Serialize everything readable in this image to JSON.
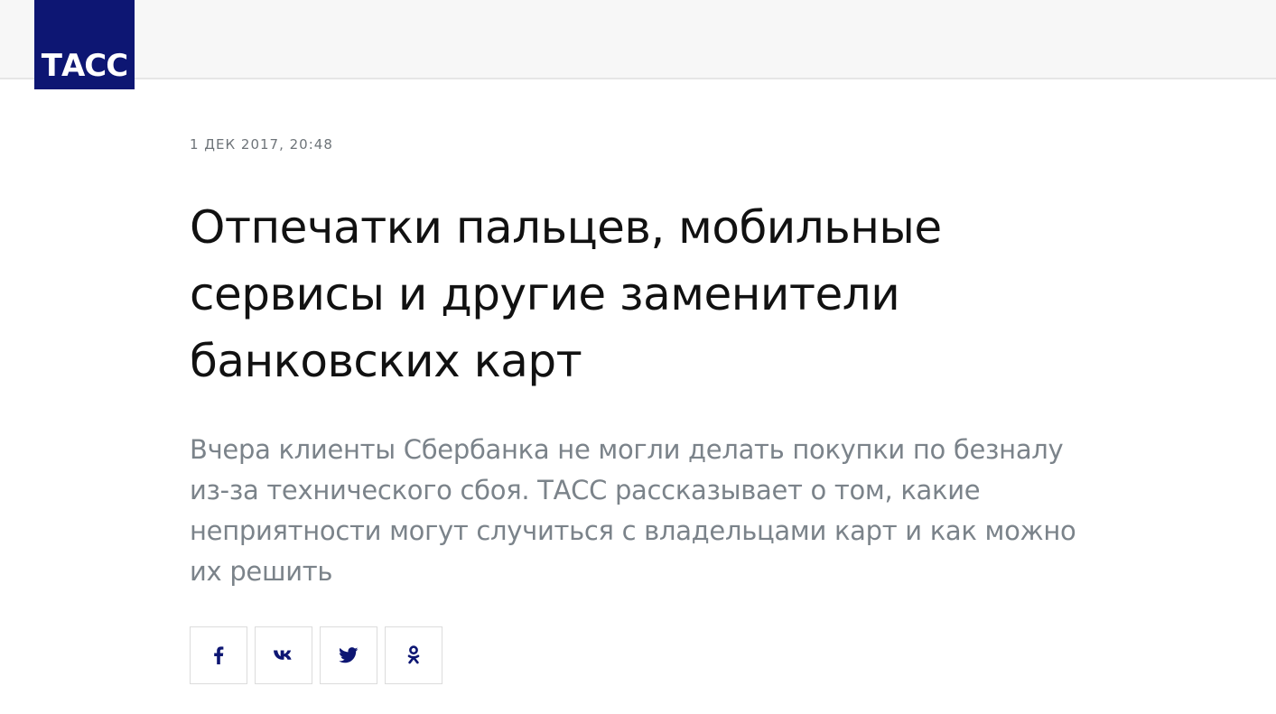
{
  "header": {
    "logo_text": "ТАСС",
    "brand_color": "#0d1673"
  },
  "article": {
    "date": "1 ДЕК 2017, 20:48",
    "title": "Отпечатки пальцев, мобильные сервисы и другие заменители банковских карт",
    "lead": "Вчера клиенты Сбербанка не могли делать покупки по безналу из-за технического сбоя. ТАСС рассказывает о том, какие неприятности могут случиться с владельцами карт и как можно их решить"
  },
  "share": {
    "icon_color": "#0d1673",
    "buttons": [
      {
        "icon": "facebook-icon"
      },
      {
        "icon": "vk-icon"
      },
      {
        "icon": "twitter-icon"
      },
      {
        "icon": "odnoklassniki-icon"
      }
    ]
  }
}
